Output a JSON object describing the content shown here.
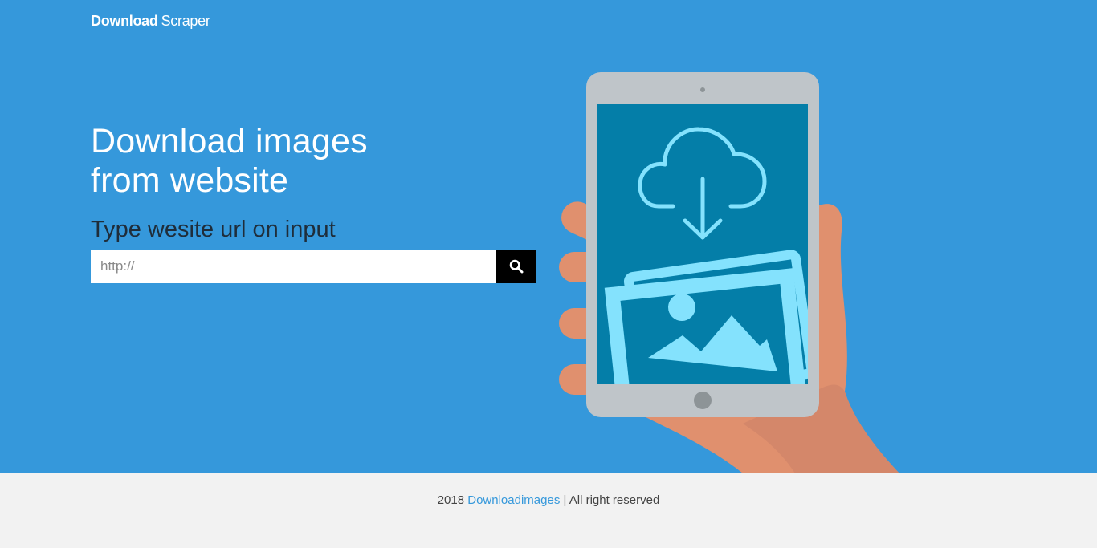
{
  "brand": {
    "bold": "Download",
    "light": "Scraper"
  },
  "hero": {
    "title_line1": "Download images",
    "title_line2": "from website",
    "subtitle": "Type wesite url on input",
    "background_color": "#3598db"
  },
  "search": {
    "placeholder": "http://",
    "value": "",
    "button_icon": "search-icon"
  },
  "illustration": {
    "icons": [
      "tablet-illustration",
      "cloud-download-icon",
      "photo-gallery-icon",
      "hand-illustration"
    ]
  },
  "footer": {
    "year": "2018",
    "link_text": "Downloadimages",
    "rights": "| All right reserved",
    "link_color": "#3598db"
  }
}
